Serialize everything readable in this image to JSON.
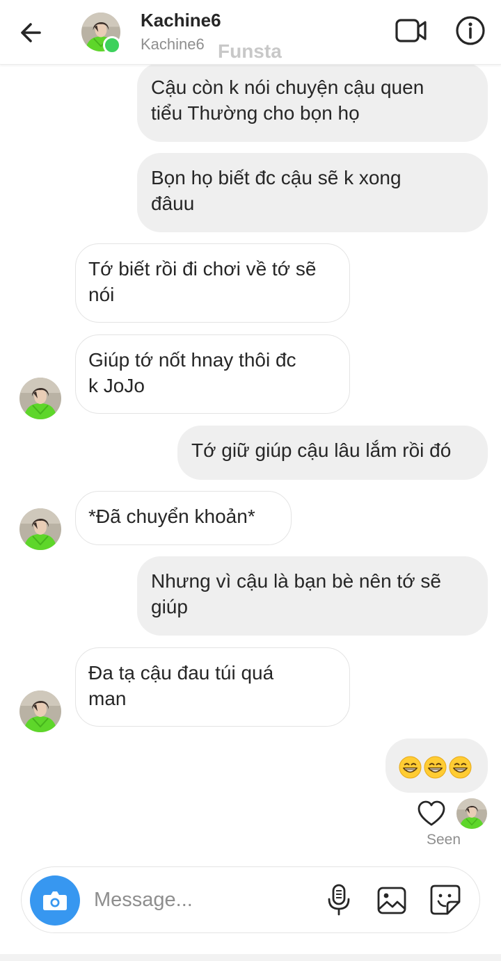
{
  "header": {
    "name": "Kachine6",
    "username": "Kachine6",
    "watermark": "Funsta",
    "back_icon": "arrow-left-icon",
    "video_icon": "video-call-icon",
    "info_icon": "info-icon"
  },
  "messages": [
    {
      "side": "out",
      "text": "Cậu còn k nói chuyện cậu quen\ntiểu Thường cho bọn họ"
    },
    {
      "side": "out",
      "text": "Bọn họ biết đc cậu sẽ k xong\nđâuu"
    },
    {
      "side": "in",
      "text": "Tớ biết rồi đi chơi về tớ sẽ\nnói"
    },
    {
      "side": "in",
      "text": "Giúp tớ nốt hnay thôi đc\nk JoJo"
    },
    {
      "side": "out",
      "text": "Tớ giữ giúp cậu lâu lắm rồi đó"
    },
    {
      "side": "in",
      "text": "*Đã chuyển khoản*"
    },
    {
      "side": "out",
      "text": "Nhưng vì cậu là bạn bè nên tớ sẽ\ngiúp"
    },
    {
      "side": "in",
      "text": "Đa tạ cậu đau túi quá\nman"
    },
    {
      "side": "out",
      "emoji": [
        "grinning-face-smiling-eyes",
        "grinning-face-smiling-eyes",
        "grinning-face-smiling-eyes"
      ]
    }
  ],
  "status": {
    "seen": "Seen",
    "heart_icon": "heart-outline-icon"
  },
  "composer": {
    "placeholder": "Message...",
    "camera_icon": "camera-icon",
    "mic_icon": "microphone-icon",
    "gallery_icon": "image-gallery-icon",
    "sticker_icon": "sticker-icon"
  },
  "colors": {
    "accent": "#3797f0",
    "online": "#3dd15c",
    "outgoing_bubble": "#efefef",
    "avatar_shirt": "#5ed62a"
  }
}
